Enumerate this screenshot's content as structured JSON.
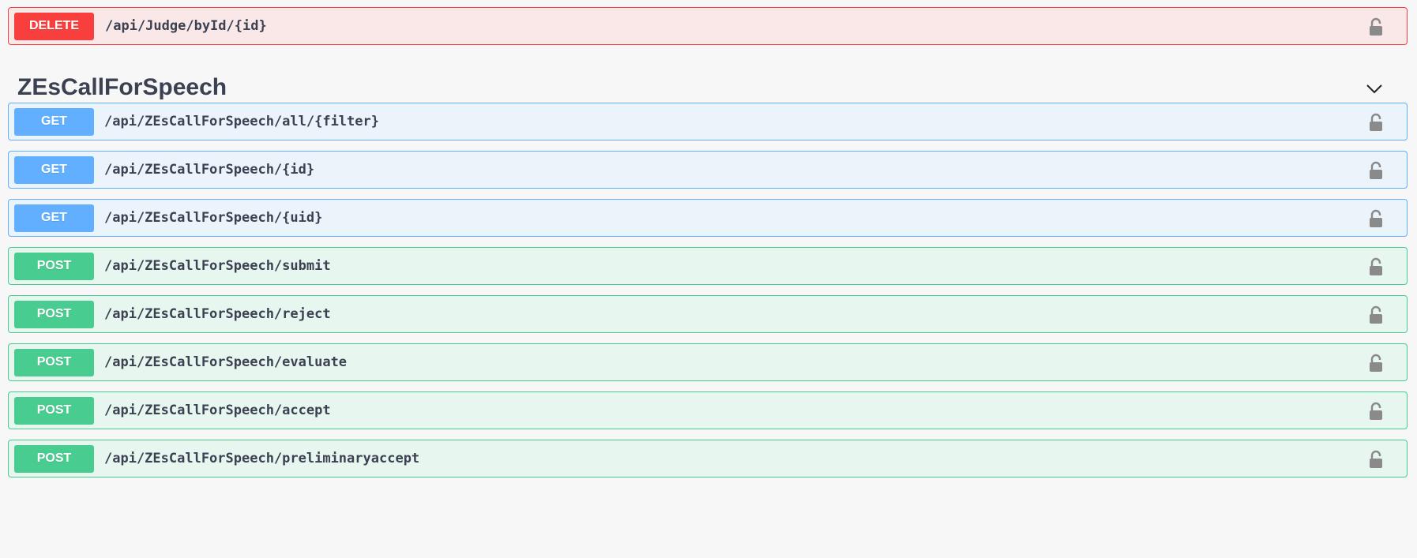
{
  "operations_top": [
    {
      "method": "DELETE",
      "path": "/api/Judge/byId/{id}"
    }
  ],
  "tag": {
    "title": "ZEsCallForSpeech",
    "expanded": true
  },
  "operations": [
    {
      "method": "GET",
      "path": "/api/ZEsCallForSpeech/all/{filter}"
    },
    {
      "method": "GET",
      "path": "/api/ZEsCallForSpeech/{id}"
    },
    {
      "method": "GET",
      "path": "/api/ZEsCallForSpeech/{uid}"
    },
    {
      "method": "POST",
      "path": "/api/ZEsCallForSpeech/submit"
    },
    {
      "method": "POST",
      "path": "/api/ZEsCallForSpeech/reject"
    },
    {
      "method": "POST",
      "path": "/api/ZEsCallForSpeech/evaluate"
    },
    {
      "method": "POST",
      "path": "/api/ZEsCallForSpeech/accept"
    },
    {
      "method": "POST",
      "path": "/api/ZEsCallForSpeech/preliminaryaccept"
    }
  ],
  "colors": {
    "delete": "#f93e3e",
    "get": "#61affe",
    "post": "#49cc90",
    "text": "#3b4151"
  },
  "icons": {
    "lock": "lock-icon",
    "chevron": "chevron-down-icon"
  }
}
